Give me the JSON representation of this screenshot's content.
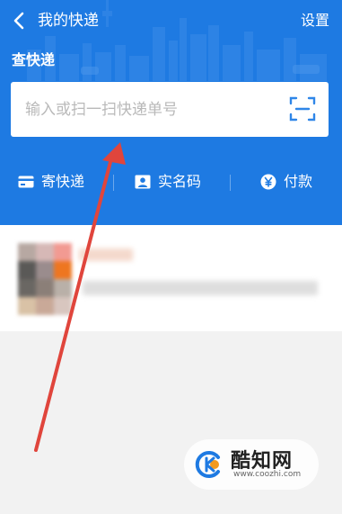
{
  "header": {
    "title": "我的快递",
    "settings_label": "设置",
    "back_icon": "chevron-left-icon"
  },
  "query": {
    "section_label": "查快递",
    "placeholder": "输入或扫一扫快递单号",
    "scan_icon": "scan-icon"
  },
  "actions": [
    {
      "label": "寄快递",
      "icon": "card-icon"
    },
    {
      "label": "实名码",
      "icon": "id-badge-icon"
    },
    {
      "label": "付款",
      "icon": "yen-icon"
    }
  ],
  "watermark": {
    "name": "酷知网",
    "url": "www.coozhi.com"
  },
  "colors": {
    "header_blue": "#1e7ae2",
    "arrow_red": "#e0453c",
    "background": "#f2f2f2"
  }
}
